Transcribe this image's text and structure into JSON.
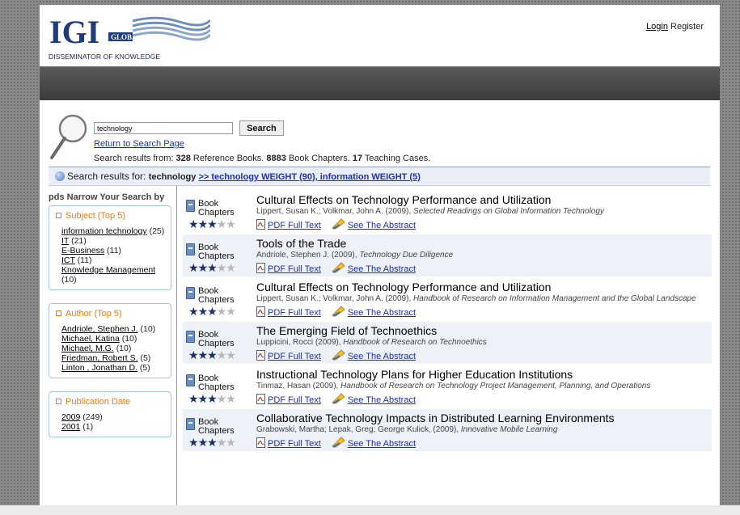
{
  "header": {
    "logo_text": "IGI",
    "logo_sub": "GLOBAL",
    "logo_tagline": "DISSEMINATOR OF KNOWLEDGE",
    "login_label": "Login",
    "register_label": "Register"
  },
  "search": {
    "query": "technology",
    "button_label": "Search",
    "return_link": "Return to Search Page",
    "summary_prefix": "Search results from: ",
    "ref_books_count": "328",
    "ref_books_label": " Reference Books. ",
    "chapters_count": "8883",
    "chapters_label": " Book Chapters. ",
    "cases_count": "17",
    "cases_label": " Teaching Cases."
  },
  "results_bar": {
    "label": "Search results for: ",
    "term": "technology",
    "weights_link": ">> technology WEIGHT (90), information WEIGHT (5)"
  },
  "sidebar": {
    "title": "pds Narrow Your Search by",
    "facets": [
      {
        "title": "Subject (Top 5)",
        "items": [
          {
            "label": "information technology",
            "count": "(25)"
          },
          {
            "label": "IT",
            "count": "(21)"
          },
          {
            "label": "E-Business",
            "count": "(11)"
          },
          {
            "label": "ICT",
            "count": "(11)"
          },
          {
            "label": "Knowledge Management",
            "count": "(10)"
          }
        ]
      },
      {
        "title": "Author (Top 5)",
        "items": [
          {
            "label": "Andriole, Stephen J.",
            "count": "(10)"
          },
          {
            "label": "Michael, Katina",
            "count": "(10)"
          },
          {
            "label": "Michael, M.G.",
            "count": "(10)"
          },
          {
            "label": "Friedman, Robert S.",
            "count": "(5)"
          },
          {
            "label": "Linton , Jonathan D.",
            "count": "(5)"
          }
        ]
      },
      {
        "title": "Publication Date",
        "items": [
          {
            "label": "2009",
            "count": "(249)"
          },
          {
            "label": "2001",
            "count": "(1)"
          }
        ]
      }
    ]
  },
  "results": {
    "type_label": "Book Chapters",
    "pdf_label": "PDF Full Text",
    "abstract_label": "See The Abstract",
    "rating": 3,
    "rating_max": 5,
    "items": [
      {
        "title": "Cultural Effects on Technology Performance and Utilization",
        "authors": "Lippert, Susan K.; Volkmar, John A. (2009), ",
        "source": "Selected Readings on Global Information Technology"
      },
      {
        "title": "Tools of the Trade",
        "authors": "Andriole, Stephen J. (2009), ",
        "source": "Technology Due Diligence"
      },
      {
        "title": "Cultural Effects on Technology Performance and Utilization",
        "authors": "Lippert, Susan K.; Volkmar, John A. (2009), ",
        "source": "Handbook of Research on Information Management and the Global Landscape"
      },
      {
        "title": "The Emerging Field of Technoethics",
        "authors": "Luppicini, Rocci (2009), ",
        "source": "Handbook of Research on Technoethics"
      },
      {
        "title": "Instructional Technology Plans for Higher Education Institutions",
        "authors": "Tinmaz, Hasan (2009), ",
        "source": "Handbook of Research on Technology Project Management, Planning, and Operations"
      },
      {
        "title": "Collaborative Technology Impacts in Distributed Learning Environments",
        "authors": "Grabowski, Martha; Lepak, Greg; George Kulick, (2009), ",
        "source": "Innovative Mobile Learning"
      }
    ]
  }
}
